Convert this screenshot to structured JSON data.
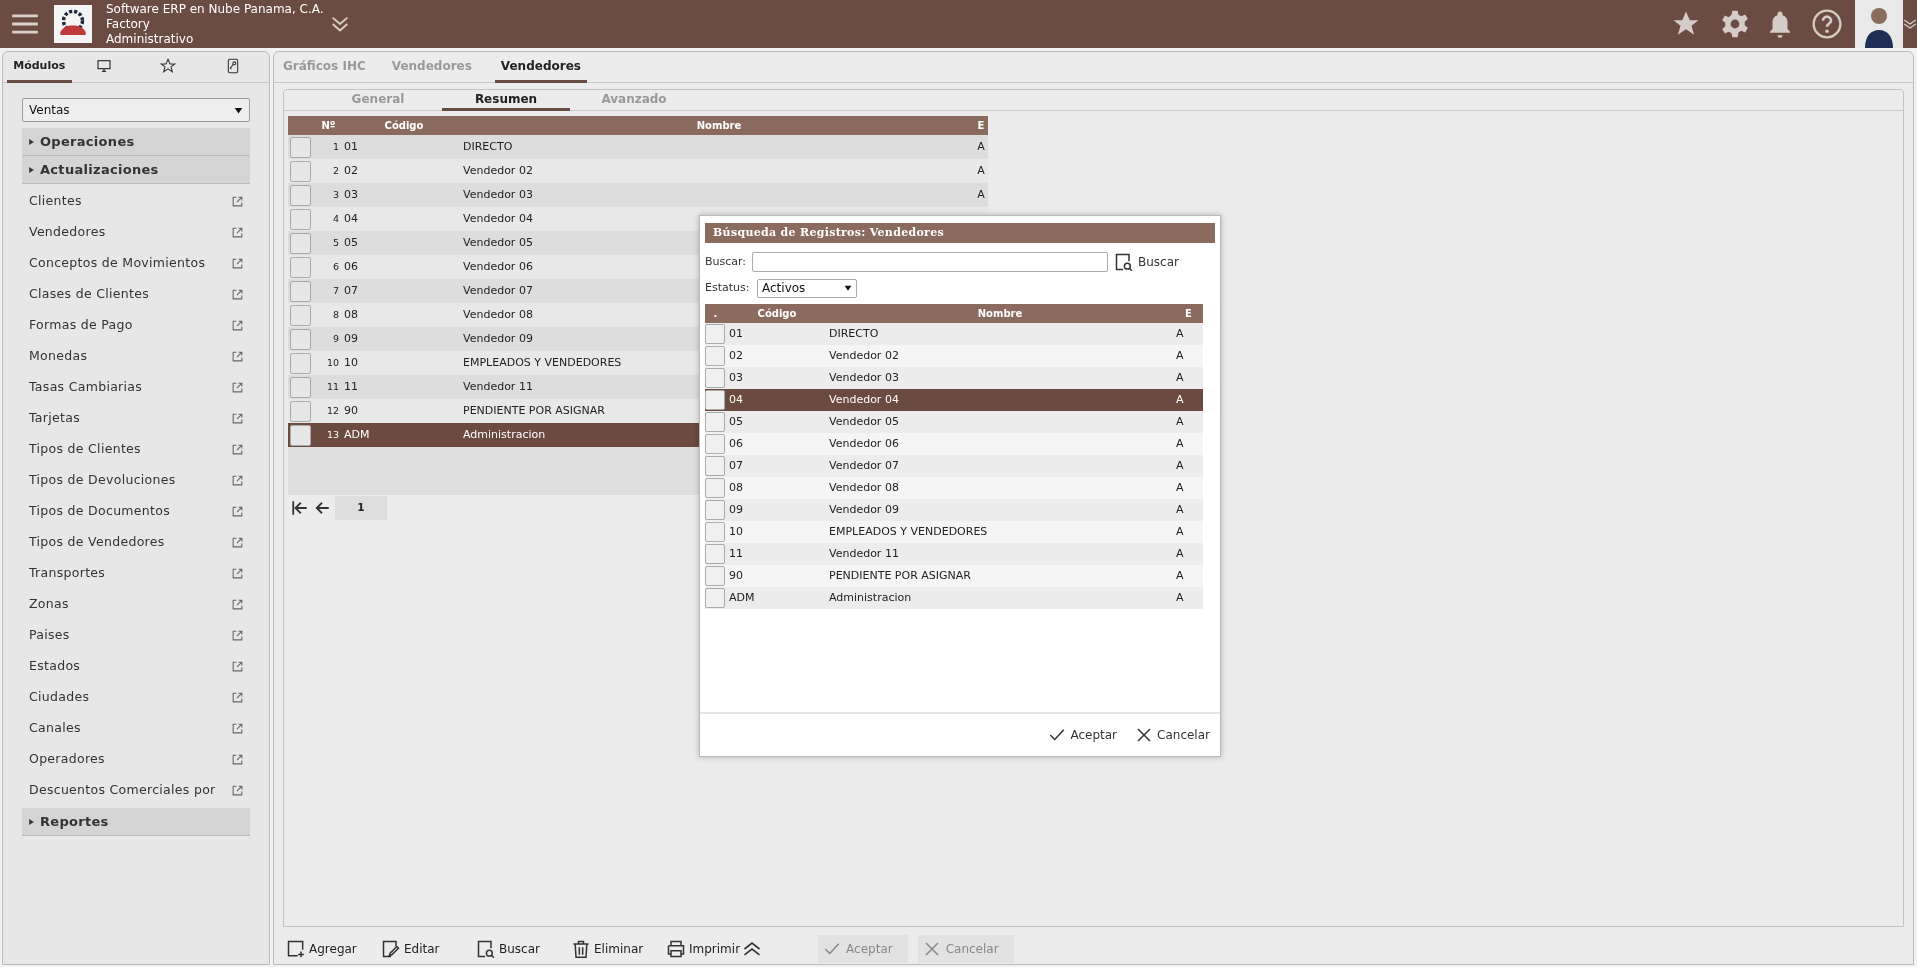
{
  "header": {
    "company": "Software ERP en Nube Panama, C.A.",
    "line_2": "Factory",
    "line_3": "Administrativo"
  },
  "sidebar": {
    "tabs": [
      {
        "kind": "text",
        "label": "Módulos",
        "selected": true
      },
      {
        "kind": "monitor",
        "selected": false
      },
      {
        "kind": "star",
        "selected": false
      },
      {
        "kind": "key",
        "selected": false
      }
    ],
    "module": "Ventas",
    "sections": [
      {
        "label": "Operaciones"
      },
      {
        "label": "Actualizaciones",
        "items": [
          "Clientes",
          "Vendedores",
          "Conceptos de Movimientos",
          "Clases de Clientes",
          "Formas de Pago",
          "Monedas",
          "Tasas Cambiarias",
          "Tarjetas",
          "Tipos de Clientes",
          "Tipos de Devoluciones",
          "Tipos de Documentos",
          "Tipos de Vendedores",
          "Transportes",
          "Zonas",
          "Paises",
          "Estados",
          "Ciudades",
          "Canales",
          "Operadores",
          "Descuentos Comerciales por"
        ]
      },
      {
        "label": "Reportes"
      }
    ]
  },
  "tabs": [
    {
      "label": "Gráficos IHC",
      "selected": false
    },
    {
      "label": "Vendedores",
      "selected": false
    },
    {
      "label": "Vendedores",
      "selected": true
    }
  ],
  "subtabs": [
    {
      "label": "General",
      "selected": false
    },
    {
      "label": "Resumen",
      "selected": true
    },
    {
      "label": "Avanzado",
      "selected": false
    }
  ],
  "table": {
    "columns": [
      "Nº",
      "Código",
      "Nombre",
      "E"
    ],
    "rows": [
      {
        "n": "1",
        "code": "01",
        "name": "DIRECTO",
        "e": "A",
        "selected": false
      },
      {
        "n": "2",
        "code": "02",
        "name": "Vendedor 02",
        "e": "A",
        "selected": false
      },
      {
        "n": "3",
        "code": "03",
        "name": "Vendedor 03",
        "e": "A",
        "selected": false
      },
      {
        "n": "4",
        "code": "04",
        "name": "Vendedor 04",
        "selected": false
      },
      {
        "n": "5",
        "code": "05",
        "name": "Vendedor 05",
        "selected": false
      },
      {
        "n": "6",
        "code": "06",
        "name": "Vendedor 06",
        "selected": false
      },
      {
        "n": "7",
        "code": "07",
        "name": "Vendedor 07",
        "selected": false
      },
      {
        "n": "8",
        "code": "08",
        "name": "Vendedor 08",
        "selected": false
      },
      {
        "n": "9",
        "code": "09",
        "name": "Vendedor 09",
        "selected": false
      },
      {
        "n": "10",
        "code": "10",
        "name": "EMPLEADOS Y VENDEDORES",
        "selected": false
      },
      {
        "n": "11",
        "code": "11",
        "name": "Vendedor 11",
        "selected": false
      },
      {
        "n": "12",
        "code": "90",
        "name": "PENDIENTE POR ASIGNAR",
        "selected": false
      },
      {
        "n": "13",
        "code": "ADM",
        "name": "Administracion",
        "selected": true
      }
    ]
  },
  "pager": {
    "page": "1"
  },
  "dialog": {
    "title": "Búsqueda de Registros: Vendedores",
    "search_label": "Buscar:",
    "search_button": "Buscar",
    "status_label": "Estatus:",
    "status_value": "Activos",
    "columns": [
      ".",
      "Código",
      "Nombre",
      "E"
    ],
    "rows": [
      {
        "code": "01",
        "name": "DIRECTO",
        "e": "A",
        "selected": false
      },
      {
        "code": "02",
        "name": "Vendedor 02",
        "e": "A",
        "selected": false
      },
      {
        "code": "03",
        "name": "Vendedor 03",
        "e": "A",
        "selected": false
      },
      {
        "code": "04",
        "name": "Vendedor 04",
        "e": "A",
        "selected": true
      },
      {
        "code": "05",
        "name": "Vendedor 05",
        "e": "A",
        "selected": false
      },
      {
        "code": "06",
        "name": "Vendedor 06",
        "e": "A",
        "selected": false
      },
      {
        "code": "07",
        "name": "Vendedor 07",
        "e": "A",
        "selected": false
      },
      {
        "code": "08",
        "name": "Vendedor 08",
        "e": "A",
        "selected": false
      },
      {
        "code": "09",
        "name": "Vendedor 09",
        "e": "A",
        "selected": false
      },
      {
        "code": "10",
        "name": "EMPLEADOS Y VENDEDORES",
        "e": "A",
        "selected": false
      },
      {
        "code": "11",
        "name": "Vendedor 11",
        "e": "A",
        "selected": false
      },
      {
        "code": "90",
        "name": "PENDIENTE POR ASIGNAR",
        "e": "A",
        "selected": false
      },
      {
        "code": "ADM",
        "name": "Administracion",
        "e": "A",
        "selected": false
      }
    ],
    "buttons": [
      {
        "kind": "accept",
        "label": "Aceptar"
      },
      {
        "kind": "cancel",
        "label": "Cancelar"
      }
    ]
  },
  "toolbar": [
    {
      "kind": "add",
      "label": "Agregar"
    },
    {
      "kind": "edit",
      "label": "Editar"
    },
    {
      "kind": "search",
      "label": "Buscar"
    },
    {
      "kind": "delete",
      "label": "Eliminar"
    },
    {
      "kind": "print",
      "label": "Imprimir"
    },
    {
      "kind": "collapse"
    },
    {
      "kind": "accept",
      "label": "Aceptar",
      "disabled": true
    },
    {
      "kind": "cancel",
      "label": "Cancelar",
      "disabled": true
    }
  ]
}
